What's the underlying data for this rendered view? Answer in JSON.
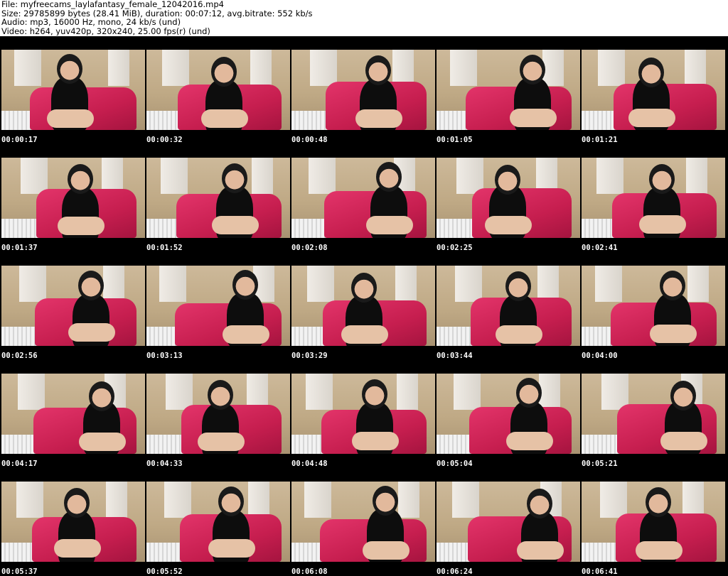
{
  "header": {
    "file_line": "File: myfreecams_laylafantasy_female_12042016.mp4",
    "size_line": "Size: 29785899 bytes (28.41 MiB), duration: 00:07:12, avg.bitrate: 552 kb/s",
    "audio_line": "Audio: mp3, 16000 Hz, mono, 24 kb/s (und)",
    "video_line": "Video: h264, yuv420p, 320x240, 25.00 fps(r) (und)"
  },
  "thumbnails": [
    {
      "timestamp": "00:00:17"
    },
    {
      "timestamp": "00:00:32"
    },
    {
      "timestamp": "00:00:48"
    },
    {
      "timestamp": "00:01:05"
    },
    {
      "timestamp": "00:01:21"
    },
    {
      "timestamp": "00:01:37"
    },
    {
      "timestamp": "00:01:52"
    },
    {
      "timestamp": "00:02:08"
    },
    {
      "timestamp": "00:02:25"
    },
    {
      "timestamp": "00:02:41"
    },
    {
      "timestamp": "00:02:56"
    },
    {
      "timestamp": "00:03:13"
    },
    {
      "timestamp": "00:03:29"
    },
    {
      "timestamp": "00:03:44"
    },
    {
      "timestamp": "00:04:00"
    },
    {
      "timestamp": "00:04:17"
    },
    {
      "timestamp": "00:04:33"
    },
    {
      "timestamp": "00:04:48"
    },
    {
      "timestamp": "00:05:04"
    },
    {
      "timestamp": "00:05:21"
    },
    {
      "timestamp": "00:05:37"
    },
    {
      "timestamp": "00:05:52"
    },
    {
      "timestamp": "00:06:08"
    },
    {
      "timestamp": "00:06:24"
    },
    {
      "timestamp": "00:06:41"
    }
  ],
  "colors": {
    "sheet_background": "#000000",
    "header_background": "#ffffff",
    "timestamp_text": "#ffffff",
    "couch": "#d42a5c"
  }
}
